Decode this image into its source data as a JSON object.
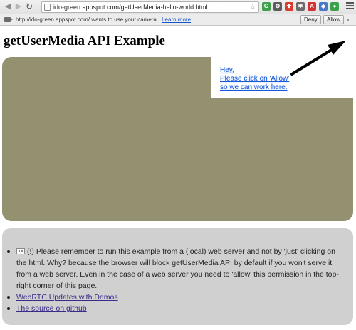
{
  "browser": {
    "url": "ido-green.appspot.com/getUserMedia-hello-world.html",
    "extensions": [
      {
        "icon": "green-extension-icon",
        "color": "#3f9f4a",
        "glyph": "G"
      },
      {
        "icon": "gear-icon",
        "color": "#5c5c5c",
        "glyph": "⚙"
      },
      {
        "icon": "red-extension-icon",
        "color": "#d93a2b",
        "glyph": "✚"
      },
      {
        "icon": "puzzle-extension-icon",
        "color": "#6b6b6b",
        "glyph": "✱"
      },
      {
        "icon": "abp-extension-icon",
        "color": "#d23232",
        "glyph": "ABP"
      },
      {
        "icon": "blue-extension-icon",
        "color": "#4a78c9",
        "glyph": "◆"
      },
      {
        "icon": "green-dot-extension-icon",
        "color": "#3aa34a",
        "glyph": "●"
      }
    ]
  },
  "infobar": {
    "message": "http://ido-green.appspot.com/ wants to use your camera.",
    "learn_more": "Learn more",
    "deny_label": "Deny",
    "allow_label": "Allow",
    "close_label": "×"
  },
  "page": {
    "title": "getUserMedia API Example",
    "video_color": "#93916f",
    "callout_lines": [
      "Hey,",
      "Please click on 'Allow'",
      "so we can work here."
    ],
    "notes": {
      "first_prefix": "(!) Please remember to run this example from a (local) web server and not by 'just' clicking on the html. Why? because the browser will block getUserMedia API by default if you won't serve it from a web server. Even in the case of a web server you need to 'allow' this permission in the top-right corner of this page.",
      "link1": "WebRTC Updates with Demos",
      "link2": "The source on github"
    }
  }
}
